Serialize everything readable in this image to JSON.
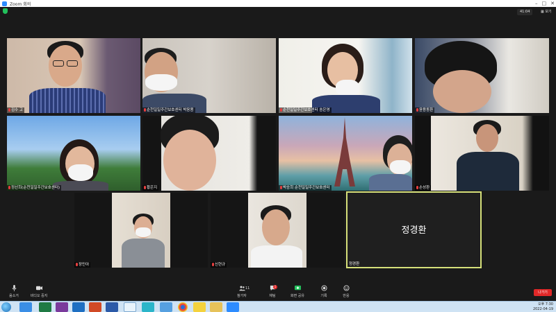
{
  "window": {
    "title": "Zoom 회의"
  },
  "header": {
    "timer": "41:04",
    "view_label": "보기"
  },
  "participants": [
    {
      "name": "김수 고"
    },
    {
      "name": "순천일일주간보호센터 박응용"
    },
    {
      "name": "순천일일주간보호센터 송은영"
    },
    {
      "name": "윤용동환"
    },
    {
      "name": "정선희(순천일일주간보호센터)"
    },
    {
      "name": "황은지"
    },
    {
      "name": "박승희 순천일일주간보호센터"
    },
    {
      "name": "손성환"
    },
    {
      "name": "장민아"
    },
    {
      "name": "신현규"
    },
    {
      "name": "정경환",
      "display_name": "정경환"
    }
  ],
  "toolbar": {
    "mute": "음소거",
    "video": "비디오 중지",
    "participants": "참가자",
    "participants_count": "11",
    "chat": "채팅",
    "chat_badge": "1",
    "share": "화면 공유",
    "record": "기록",
    "reactions": "반응",
    "end": "나가기"
  },
  "taskbar": {
    "time": "오후 7:30",
    "date": "2022-04-19"
  },
  "colors": {
    "accent": "#2d8cff",
    "share_green": "#23c15c",
    "end_red": "#e02828",
    "active_border": "#d6e07a"
  }
}
